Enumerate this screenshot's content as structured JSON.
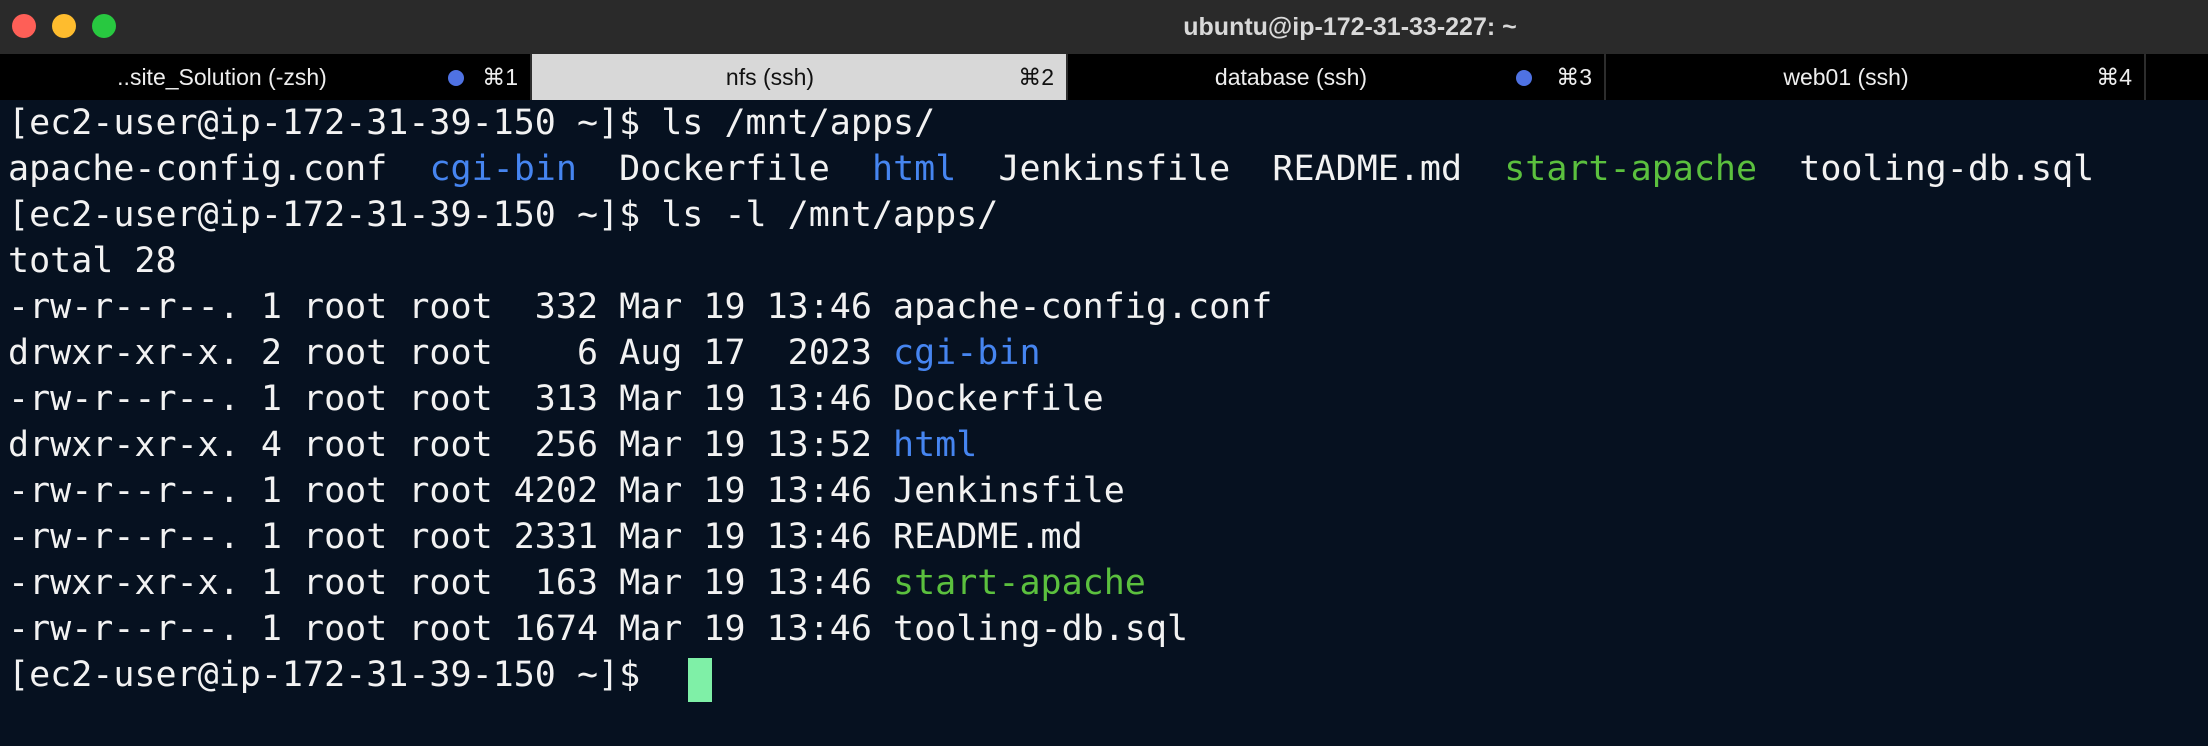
{
  "window": {
    "title": "ubuntu@ip-172-31-33-227: ~",
    "colors": {
      "background": "#061120",
      "close": "#fe5f57",
      "minimize": "#febc2e",
      "zoom": "#28c840",
      "directory": "#4685f0",
      "executable": "#5bc03e",
      "cursor": "#7ff0a7"
    }
  },
  "tabs": [
    {
      "label": "..site_Solution (-zsh)",
      "shortcut": "⌘1",
      "active": false,
      "dot": true
    },
    {
      "label": "nfs (ssh)",
      "shortcut": "⌘2",
      "active": true,
      "dot": false
    },
    {
      "label": "database (ssh)",
      "shortcut": "⌘3",
      "active": false,
      "dot": true
    },
    {
      "label": "web01 (ssh)",
      "shortcut": "⌘4",
      "active": false,
      "dot": false
    }
  ],
  "terminal": {
    "prompt_1": "[ec2-user@ip-172-31-39-150 ~]$ ls /mnt/apps/",
    "ls_output": [
      {
        "text": "apache-config.conf",
        "type": "file"
      },
      {
        "text": "cgi-bin",
        "type": "directory"
      },
      {
        "text": "Dockerfile",
        "type": "file"
      },
      {
        "text": "html",
        "type": "directory"
      },
      {
        "text": "Jenkinsfile",
        "type": "file"
      },
      {
        "text": "README.md",
        "type": "file"
      },
      {
        "text": "start-apache",
        "type": "executable"
      },
      {
        "text": "tooling-db.sql",
        "type": "file"
      }
    ],
    "prompt_2": "[ec2-user@ip-172-31-39-150 ~]$ ls -l /mnt/apps/",
    "total": "total 28",
    "long_listing": [
      {
        "meta": "-rw-r--r--. 1 root root  332 Mar 19 13:46 ",
        "name": "apache-config.conf",
        "type": "file"
      },
      {
        "meta": "drwxr-xr-x. 2 root root    6 Aug 17  2023 ",
        "name": "cgi-bin",
        "type": "directory"
      },
      {
        "meta": "-rw-r--r--. 1 root root  313 Mar 19 13:46 ",
        "name": "Dockerfile",
        "type": "file"
      },
      {
        "meta": "drwxr-xr-x. 4 root root  256 Mar 19 13:52 ",
        "name": "html",
        "type": "directory"
      },
      {
        "meta": "-rw-r--r--. 1 root root 4202 Mar 19 13:46 ",
        "name": "Jenkinsfile",
        "type": "file"
      },
      {
        "meta": "-rw-r--r--. 1 root root 2331 Mar 19 13:46 ",
        "name": "README.md",
        "type": "file"
      },
      {
        "meta": "-rwxr-xr-x. 1 root root  163 Mar 19 13:46 ",
        "name": "start-apache",
        "type": "executable"
      },
      {
        "meta": "-rw-r--r--. 1 root root 1674 Mar 19 13:46 ",
        "name": "tooling-db.sql",
        "type": "file"
      }
    ],
    "prompt_3": "[ec2-user@ip-172-31-39-150 ~]$ "
  }
}
